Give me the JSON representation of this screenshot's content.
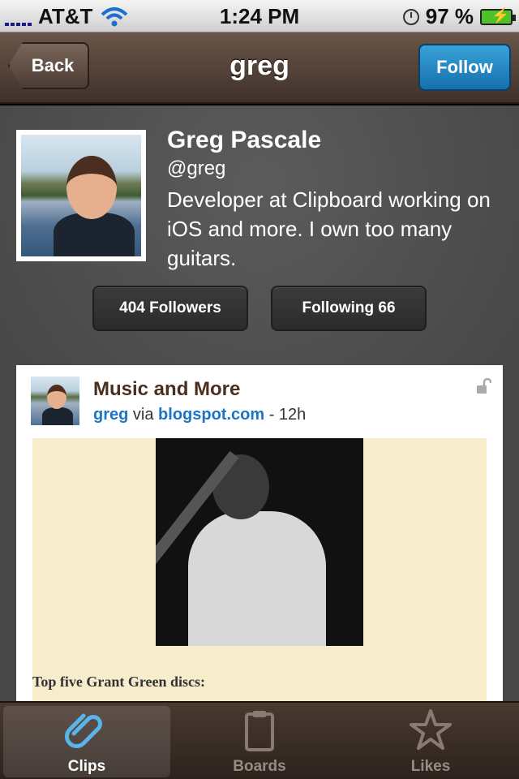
{
  "status_bar": {
    "carrier": "AT&T",
    "time": "1:24 PM",
    "battery": "97 %"
  },
  "nav": {
    "back_label": "Back",
    "title": "greg",
    "follow_label": "Follow"
  },
  "profile": {
    "name": "Greg Pascale",
    "handle": "@greg",
    "bio": "Developer at Clipboard working on iOS and more. I own too many guitars.",
    "followers_label": "404 Followers",
    "following_label": "Following 66"
  },
  "clip": {
    "title": "Music and More",
    "author": "greg",
    "via": "via",
    "source": "blogspot.com",
    "age": "- 12h",
    "caption": "Top five Grant Green discs:"
  },
  "tabs": [
    {
      "label": "Clips",
      "icon": "clips-icon",
      "active": true
    },
    {
      "label": "Boards",
      "icon": "board-icon",
      "active": false
    },
    {
      "label": "Likes",
      "icon": "star-icon",
      "active": false
    }
  ],
  "colors": {
    "nav_brown": "#4f3f36",
    "follow_blue": "#1f80c0",
    "link_blue": "#1a75c8",
    "title_brown": "#4a2f1e"
  }
}
